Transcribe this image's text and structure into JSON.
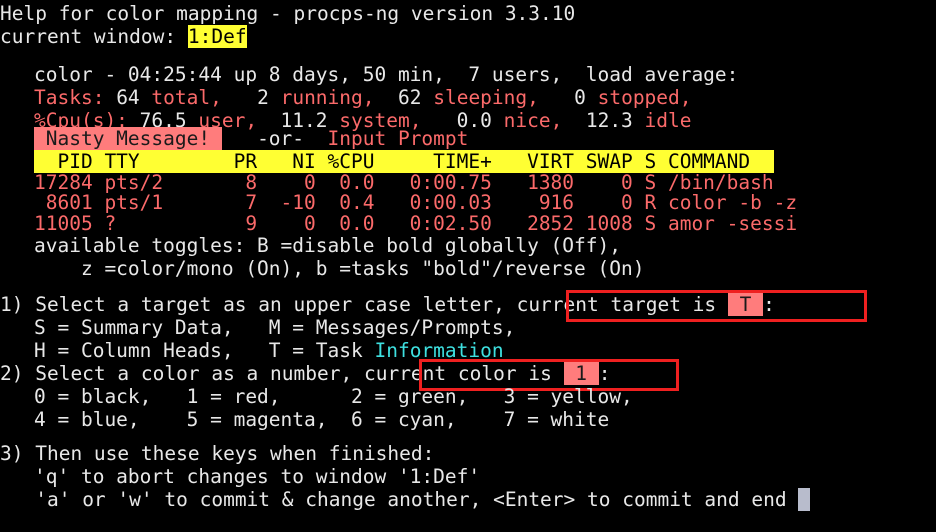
{
  "terminal": {
    "title": "Help for color mapping - procps-ng version 3.3.10",
    "window_label": "current window:",
    "window_value": "1:Def",
    "cols": 82,
    "rows": 23,
    "bg_color": "#000000",
    "fg_color": "#e8e8e8",
    "accent_red": "#fb6a6a",
    "accent_yellow": "#ffff33",
    "accent_cyan": "#3ee0e0",
    "highlight_salmon": "#ff7c7c",
    "box_outline": "#ef2020",
    "cursor_color": "#b8bccc"
  },
  "preview": {
    "uptime_line": "color - 04:25:44 up 8 days, 50 min,  7 users,  load average:",
    "tasks": {
      "label1": "Tasks:",
      "v1": " 64",
      "l1": " total,",
      "v2": "   2",
      "l2": " running,",
      "v3": "  62",
      "l3": " sleeping,",
      "v4": "   0",
      "l4": " stopped,"
    },
    "cpu": {
      "label1": "%Cpu(s):",
      "v1": " 76.5",
      "l1": " user,",
      "v2": "  11.2",
      "l2": " system,",
      "v3": "   0.0",
      "l3": " nice,",
      "v4": "  12.3",
      "l4": " idle"
    },
    "message": {
      "nasty": " Nasty Message! ",
      "or": "   -or-  ",
      "prompt": "Input Prompt"
    },
    "columns_header": "  PID TTY        PR   NI %CPU     TIME+   VIRT SWAP S COMMAND  ",
    "task_rows": [
      "17284 pts/2       8    0  0.0   0:00.75   1380    0 S /bin/bash",
      " 8601 pts/1       7  -10  0.4   0:00.03    916    0 R color -b -z",
      "11005 ?           9    0  0.0   0:02.50   2852 1008 S amor -sessi"
    ],
    "toggles_line1": "available toggles: B =disable bold globally (Off),",
    "toggles_line2": "    z =color/mono (On), b =tasks \"bold\"/reverse (On)"
  },
  "instructions": {
    "step1": {
      "number": "1)",
      "text": " Select a target as an upper case letter,",
      "box_prefix": "current target is ",
      "box_value": " T ",
      "box_suffix": ":"
    },
    "targets_line1": "S = Summary Data,   M = Messages/Prompts,",
    "targets_line2_a": "H = Column Heads,   T = Task ",
    "targets_line2_b": "Information",
    "step2": {
      "number": "2)",
      "text": " Select a color as a number,",
      "box_prefix": "current color is ",
      "box_value": " 1 ",
      "box_suffix": ":"
    },
    "colors_line1": "0 = black,   1 = red,      2 = green,   3 = yellow,",
    "colors_line2": "4 = blue,    5 = magenta,  6 = cyan,    7 = white",
    "step3": {
      "number": "3)",
      "text": " Then use these keys when finished:"
    },
    "keys_line1": "'q' to abort changes to window '1:Def'",
    "keys_line2": "'a' or 'w' to commit & change another, <Enter> to commit and end "
  }
}
